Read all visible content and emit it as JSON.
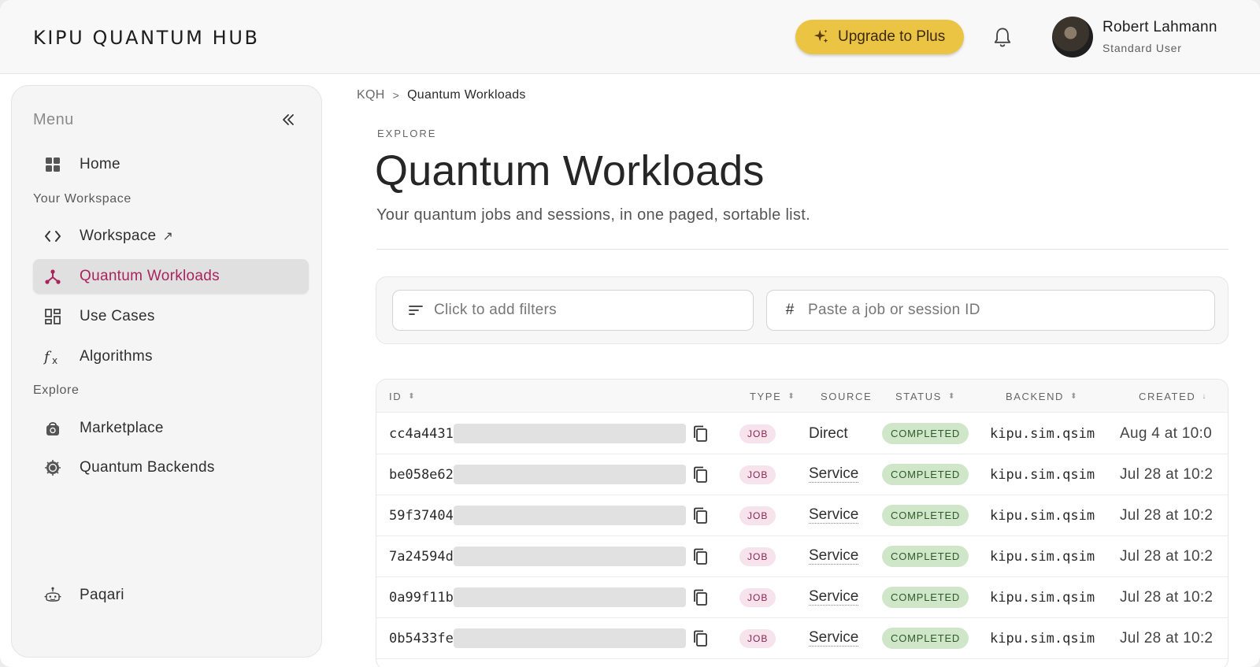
{
  "header": {
    "logo": "KIPU QUANTUM HUB",
    "upgrade_label": "Upgrade to Plus",
    "user": {
      "name": "Robert Lahmann",
      "role": "Standard User"
    }
  },
  "sidebar": {
    "title": "Menu",
    "home": {
      "label": "Home",
      "icon": "grid-icon"
    },
    "section_workspace": "Your Workspace",
    "workspace": {
      "label": "Workspace",
      "icon": "code-icon",
      "external": "↗"
    },
    "workloads": {
      "label": "Quantum Workloads",
      "icon": "network-icon",
      "active": true
    },
    "use_cases": {
      "label": "Use Cases",
      "icon": "dashboard-icon"
    },
    "algorithms": {
      "label": "Algorithms",
      "icon": "function-icon"
    },
    "section_explore": "Explore",
    "marketplace": {
      "label": "Marketplace",
      "icon": "shopping-bag-icon"
    },
    "backends": {
      "label": "Quantum Backends",
      "icon": "chip-icon"
    },
    "assistant": {
      "label": "Paqari",
      "icon": "robot-icon"
    }
  },
  "breadcrumb": {
    "root": "KQH",
    "separator": ">",
    "current": "Quantum Workloads"
  },
  "page": {
    "eyebrow": "EXPLORE",
    "title": "Quantum Workloads",
    "subtitle": "Your quantum jobs and sessions, in one paged, sortable list."
  },
  "filters": {
    "filter_placeholder": "Click to add filters",
    "id_prefix": "#",
    "id_placeholder": "Paste a job or session ID"
  },
  "table": {
    "columns": [
      "ID",
      "TYPE",
      "SOURCE",
      "STATUS",
      "BACKEND",
      "CREATED"
    ],
    "sort_indicators": [
      "⬍",
      "⬍",
      "",
      "⬍",
      "⬍",
      "↓"
    ],
    "rows": [
      {
        "id": "cc4a4431",
        "type": "JOB",
        "source": "Direct",
        "status": "COMPLETED",
        "backend": "kipu.sim.qsim",
        "created": "Aug 4 at 10:0"
      },
      {
        "id": "be058e62",
        "type": "JOB",
        "source": "Service",
        "status": "COMPLETED",
        "backend": "kipu.sim.qsim",
        "created": "Jul 28 at 10:2"
      },
      {
        "id": "59f37404",
        "type": "JOB",
        "source": "Service",
        "status": "COMPLETED",
        "backend": "kipu.sim.qsim",
        "created": "Jul 28 at 10:2"
      },
      {
        "id": "7a24594d",
        "type": "JOB",
        "source": "Service",
        "status": "COMPLETED",
        "backend": "kipu.sim.qsim",
        "created": "Jul 28 at 10:2"
      },
      {
        "id": "0a99f11b",
        "type": "JOB",
        "source": "Service",
        "status": "COMPLETED",
        "backend": "kipu.sim.qsim",
        "created": "Jul 28 at 10:2"
      },
      {
        "id": "0b5433fe",
        "type": "JOB",
        "source": "Service",
        "status": "COMPLETED",
        "backend": "kipu.sim.qsim",
        "created": "Jul 28 at 10:2"
      }
    ]
  },
  "colors": {
    "accent": "#a8245e",
    "upgrade": "#ecc443",
    "status_completed_bg": "#cfe6c9",
    "type_job_bg": "#f6e3ec"
  }
}
